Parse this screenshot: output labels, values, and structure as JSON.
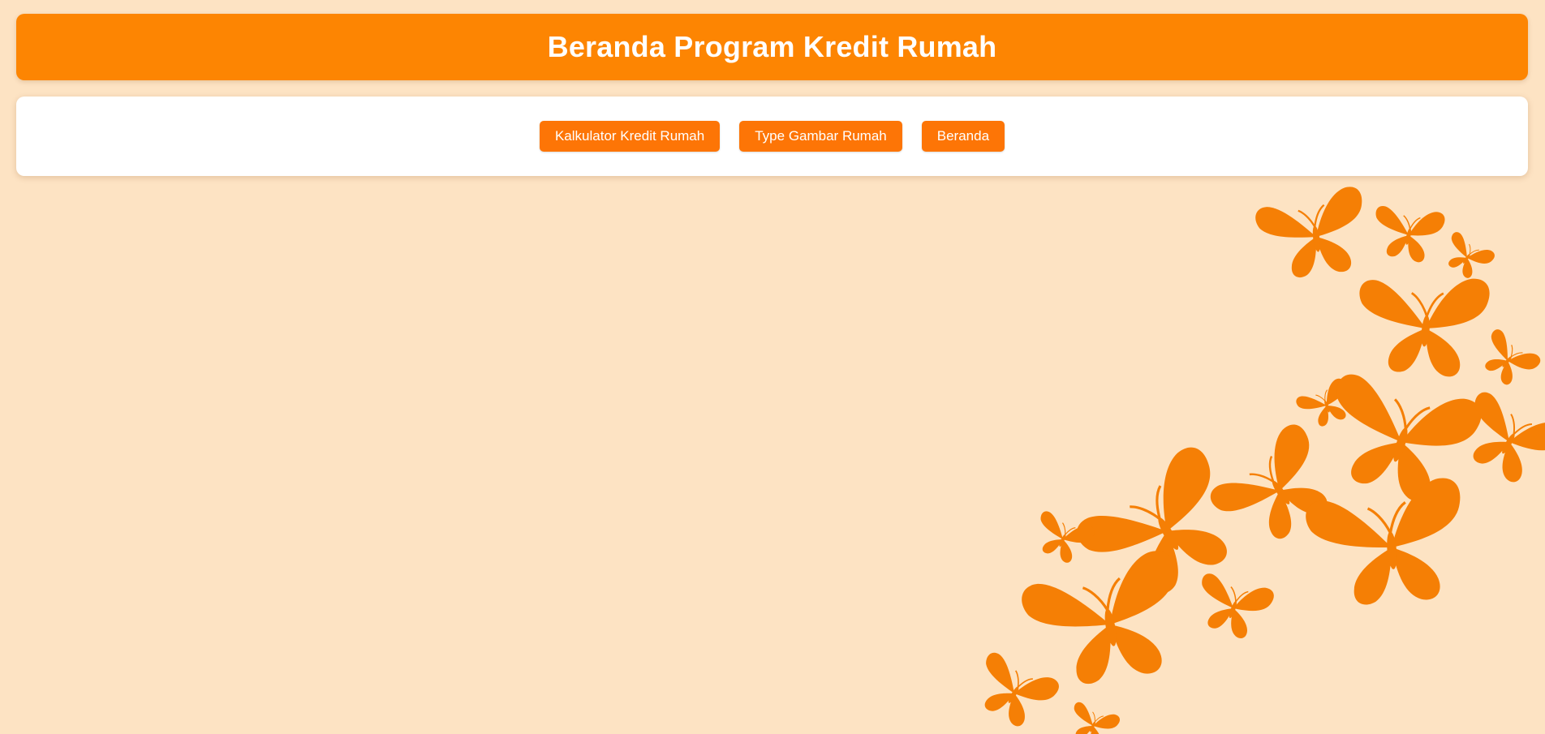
{
  "header": {
    "title": "Beranda Program Kredit Rumah"
  },
  "nav": {
    "buttons": [
      {
        "label": "Kalkulator Kredit Rumah"
      },
      {
        "label": "Type Gambar Rumah"
      },
      {
        "label": "Beranda"
      }
    ]
  },
  "theme": {
    "background": "#fde3c3",
    "accent": "#fd8502",
    "button": "#fd7506",
    "butterfly": "#f57f05"
  },
  "decoration": {
    "icon": "butterfly-icon"
  }
}
